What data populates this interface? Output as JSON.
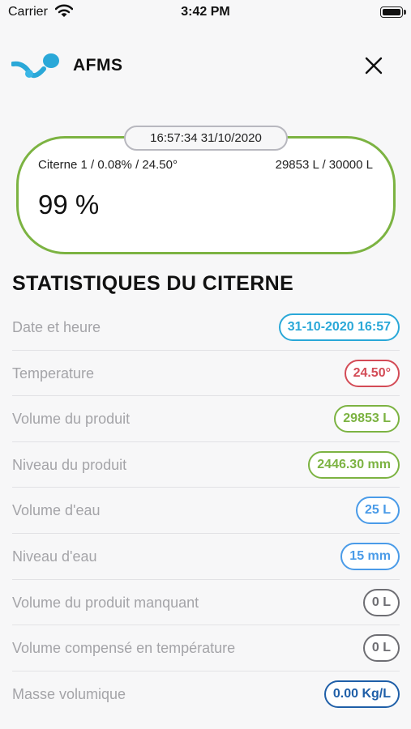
{
  "status_bar": {
    "carrier": "Carrier",
    "time": "3:42 PM"
  },
  "header": {
    "brand": "AFMS"
  },
  "tank": {
    "timestamp": "16:57:34 31/10/2020",
    "info_left": "Citerne 1 / 0.08% / 24.50°",
    "info_right": "29853 L / 30000 L",
    "fill_percent": "99 %"
  },
  "section_title": "STATISTIQUES DU CITERNE",
  "stats": [
    {
      "label": "Date et heure",
      "value": "31-10-2020 16:57",
      "color": "#2aa8d8"
    },
    {
      "label": "Temperature",
      "value": "24.50°",
      "color": "#d34b56"
    },
    {
      "label": "Volume du produit",
      "value": "29853 L",
      "color": "#7cb342"
    },
    {
      "label": "Niveau du produit",
      "value": "2446.30 mm",
      "color": "#7cb342"
    },
    {
      "label": "Volume d'eau",
      "value": "25 L",
      "color": "#4a9be8"
    },
    {
      "label": "Niveau d'eau",
      "value": "15 mm",
      "color": "#4a9be8"
    },
    {
      "label": "Volume du produit manquant",
      "value": "0 L",
      "color": "#6e6e73"
    },
    {
      "label": "Volume compensé en température",
      "value": "0 L",
      "color": "#6e6e73"
    },
    {
      "label": "Masse volumique",
      "value": "0.00 Kg/L",
      "color": "#1f5fa8"
    }
  ],
  "colors": {
    "tank_border": "#7cb342",
    "logo": "#2aa8d8"
  },
  "icons": {
    "logo": "afms-logo",
    "close": "close-icon",
    "wifi": "wifi-icon",
    "battery": "battery-icon"
  }
}
